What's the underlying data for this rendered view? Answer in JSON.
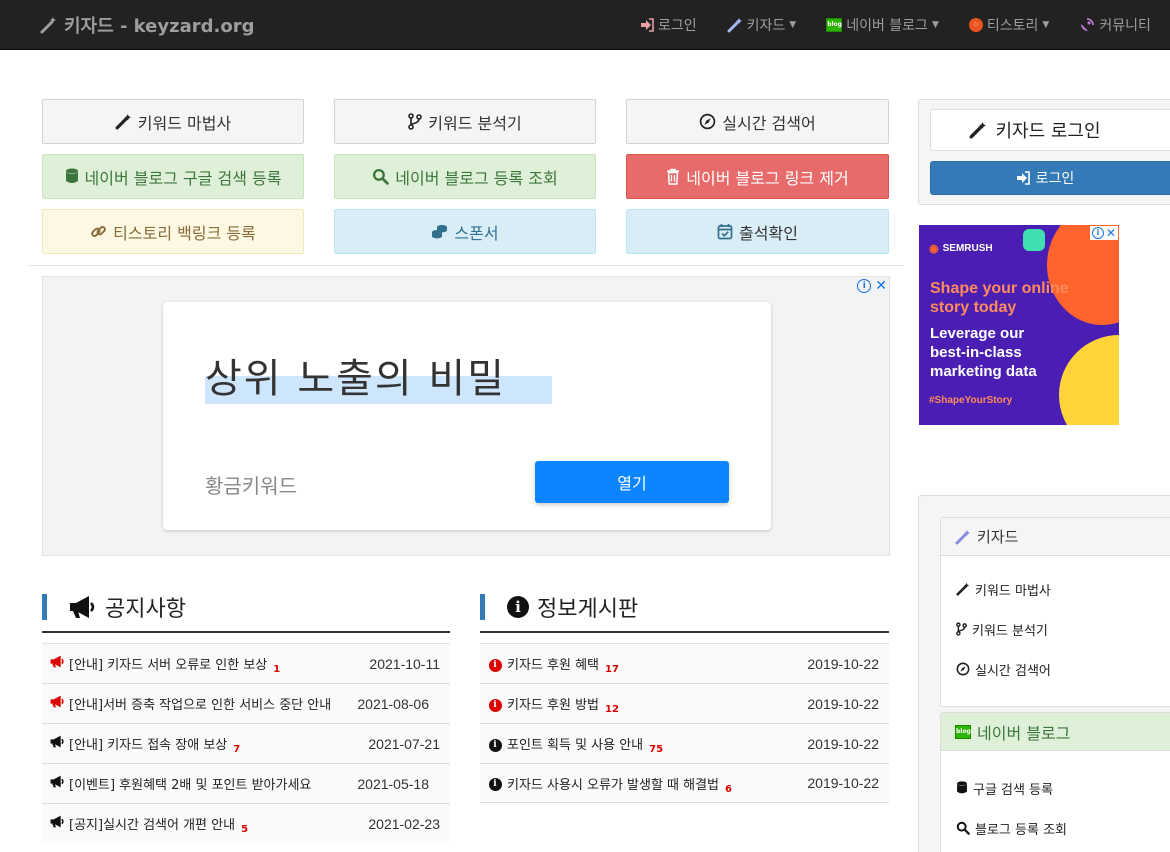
{
  "navbar": {
    "brand": "키자드 - keyzard.org",
    "items": [
      {
        "label": "로그인",
        "icon": "sign-in-icon",
        "dropdown": false
      },
      {
        "label": "키자드",
        "icon": "magic-wand-icon",
        "dropdown": true
      },
      {
        "label": "네이버 블로그",
        "icon": "naver-blog-icon",
        "dropdown": true
      },
      {
        "label": "티스토리",
        "icon": "tistory-icon",
        "dropdown": true
      },
      {
        "label": "커뮤니티",
        "icon": "satellite-dish-icon",
        "dropdown": false
      }
    ],
    "blog_badge": "blog"
  },
  "buttons": {
    "keyword_wizard": "키워드 마법사",
    "keyword_analyzer": "키워드 분석기",
    "realtime_search": "실시간 검색어",
    "naver_google_register": "네이버 블로그 구글 검색 등록",
    "naver_register_check": "네이버 블로그 등록 조회",
    "naver_link_remove": "네이버 블로그 링크 제거",
    "tistory_backlink": "티스토리 백링크 등록",
    "sponsor": "스폰서",
    "attendance": "출석확인"
  },
  "ad_main": {
    "headline": "상위 노출의 비밀",
    "advertiser": "황금키워드",
    "open_label": "열기",
    "info_glyph": "i",
    "close_glyph": "✕"
  },
  "notice_board": {
    "title": "공지사항",
    "rows": [
      {
        "text": "[안내] 키자드 서버 오류로 인한 보상",
        "count": "1",
        "date": "2021-10-11",
        "icon_color": "red"
      },
      {
        "text": "[안내]서버 증축 작업으로 인한 서비스 중단 안내",
        "count": "",
        "date": "2021-08-06",
        "icon_color": "red"
      },
      {
        "text": "[안내] 키자드 접속 장애 보상",
        "count": "7",
        "date": "2021-07-21",
        "icon_color": "black"
      },
      {
        "text": "[이벤트] 후원혜택 2배 및 포인트 받아가세요",
        "count": "",
        "date": "2021-05-18",
        "icon_color": "black"
      },
      {
        "text": "[공지]실시간 검색어 개편 안내",
        "count": "5",
        "date": "2021-02-23",
        "icon_color": "black"
      }
    ]
  },
  "info_board": {
    "title": "정보게시판",
    "rows": [
      {
        "text": "키자드 후원 혜택",
        "count": "17",
        "date": "2019-10-22",
        "icon_color": "red"
      },
      {
        "text": "키자드 후원 방법",
        "count": "12",
        "date": "2019-10-22",
        "icon_color": "red"
      },
      {
        "text": "포인트 획득 및 사용 안내",
        "count": "75",
        "date": "2019-10-22",
        "icon_color": "black"
      },
      {
        "text": "키자드 사용시 오류가 발생할 때 해결법",
        "count": "6",
        "date": "2019-10-22",
        "icon_color": "black"
      }
    ]
  },
  "login_panel": {
    "title": "키자드 로그인",
    "button": "로그인"
  },
  "side_ad": {
    "brand": "SEMRUSH",
    "headline": "Shape your online story today",
    "body": "Leverage our best-in-class marketing data",
    "hashtag": "#ShapeYourStory",
    "colors": {
      "bg": "#4a1eb3",
      "accent": "#ff642d",
      "yellow": "#ffd43b",
      "green": "#3ee0b2"
    }
  },
  "side_menu": {
    "keyzard_title": "키자드",
    "keyzard_items": [
      "키워드 마법사",
      "키워드 분석기",
      "실시간 검색어"
    ],
    "naver_title": "네이버 블로그",
    "naver_items": [
      "구글 검색 등록",
      "블로그 등록 조회"
    ]
  },
  "colors": {
    "navbar": "#222222",
    "primary": "#337ab7",
    "danger": "#e86b6b",
    "success_bg": "#dff0d8",
    "info_bg": "#d9edf7",
    "warning_bg": "#fcf8e3"
  }
}
